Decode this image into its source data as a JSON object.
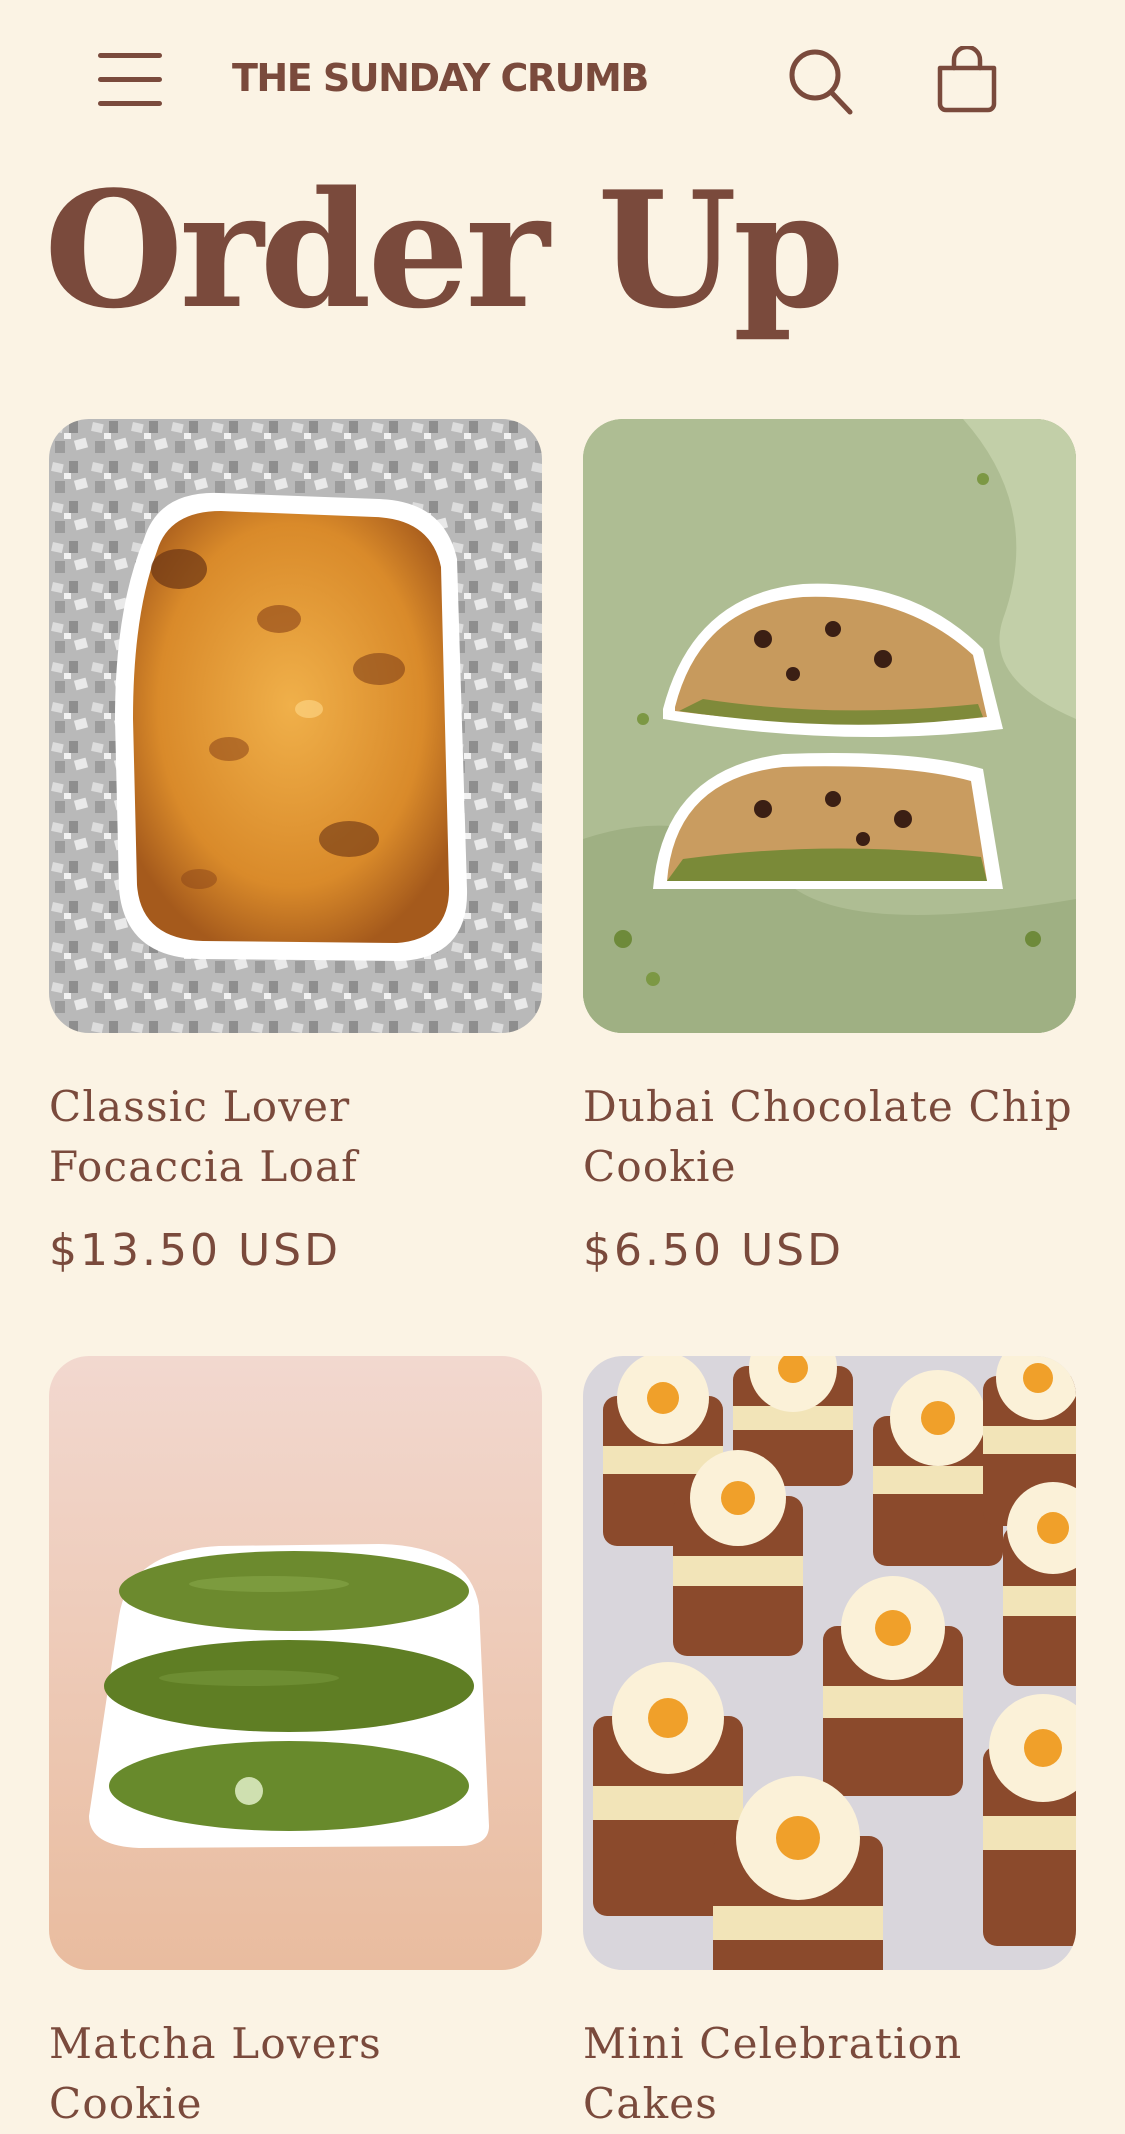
{
  "header": {
    "menu_icon": "hamburger-menu-icon",
    "logo_text": "THE SUNDAY CRUMB",
    "search_icon": "search-icon",
    "cart_icon": "shopping-bag-icon"
  },
  "page": {
    "title": "Order Up"
  },
  "products": [
    {
      "name": "Classic Lover Focaccia Loaf",
      "price": "$13.50 USD"
    },
    {
      "name": "Dubai Chocolate Chip Cookie",
      "price": "$6.50 USD"
    },
    {
      "name": "Matcha Lovers Cookie",
      "price": ""
    },
    {
      "name": "Mini Celebration Cakes",
      "price": ""
    }
  ],
  "colors": {
    "background": "#fbf3e4",
    "brand_brown": "#7a4a3c"
  }
}
